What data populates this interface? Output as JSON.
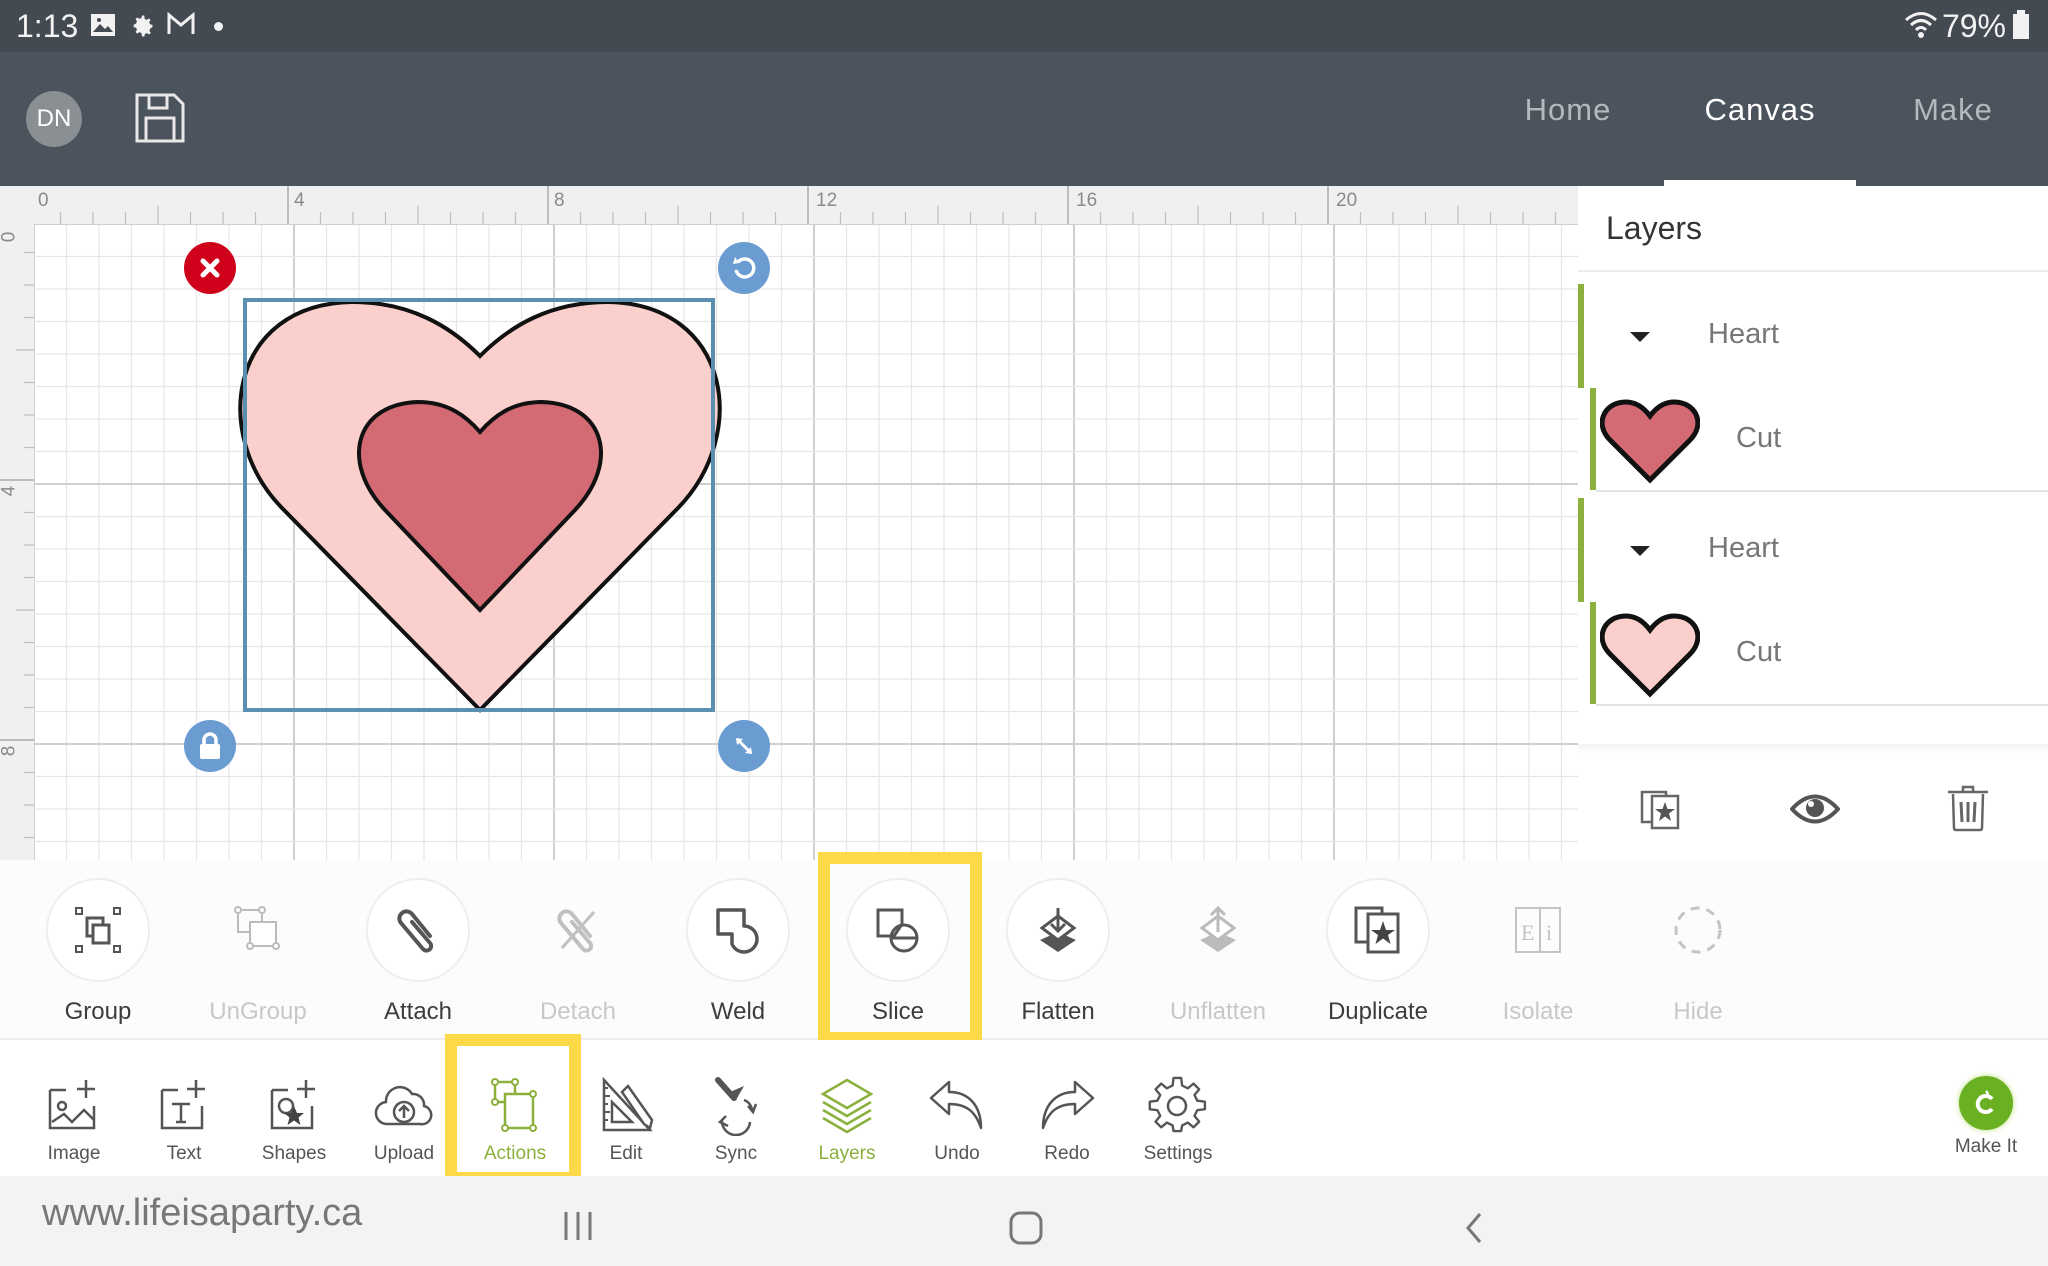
{
  "status_bar": {
    "time": "1:13",
    "left_icons": [
      "gallery-icon",
      "settings-icon",
      "gmail-icon",
      "dot-icon"
    ],
    "battery": "79%"
  },
  "header": {
    "avatar_initials": "DN",
    "save_icon": "floppy-disk-icon",
    "tabs": [
      {
        "label": "Home",
        "active": false
      },
      {
        "label": "Canvas",
        "active": true
      },
      {
        "label": "Make",
        "active": false
      }
    ]
  },
  "canvas": {
    "ruler_top_labels": [
      "0",
      "4",
      "8",
      "12",
      "16",
      "20"
    ],
    "ruler_left_labels": [
      "0",
      "4",
      "8"
    ],
    "selection_handles": [
      "delete-icon",
      "rotate-icon",
      "lock-icon",
      "resize-icon"
    ],
    "colors": {
      "outer_heart": "#fbd0cc",
      "inner_heart": "#d46a74",
      "selection": "#5b8fb0",
      "delete_handle": "#d0021b",
      "handle_blue": "#6a9bd1"
    }
  },
  "layers_panel": {
    "title": "Layers",
    "groups": [
      {
        "name": "Heart",
        "item": {
          "label": "Cut",
          "color": "#d46a74"
        }
      },
      {
        "name": "Heart",
        "item": {
          "label": "Cut",
          "color": "#fbd0cc"
        }
      }
    ],
    "footer_icons": [
      "duplicate-icon",
      "eye-icon",
      "trash-icon"
    ]
  },
  "actions_bar": {
    "items": [
      {
        "label": "Group",
        "icon": "group-icon",
        "enabled": true
      },
      {
        "label": "UnGroup",
        "icon": "ungroup-icon",
        "enabled": false
      },
      {
        "label": "Attach",
        "icon": "paperclip-icon",
        "enabled": true
      },
      {
        "label": "Detach",
        "icon": "detach-icon",
        "enabled": false
      },
      {
        "label": "Weld",
        "icon": "weld-icon",
        "enabled": true
      },
      {
        "label": "Slice",
        "icon": "slice-icon",
        "enabled": true,
        "highlighted": true
      },
      {
        "label": "Flatten",
        "icon": "flatten-icon",
        "enabled": true
      },
      {
        "label": "Unflatten",
        "icon": "unflatten-icon",
        "enabled": false
      },
      {
        "label": "Duplicate",
        "icon": "duplicate-icon",
        "enabled": true
      },
      {
        "label": "Isolate",
        "icon": "isolate-icon",
        "enabled": false
      },
      {
        "label": "Hide",
        "icon": "hide-icon",
        "enabled": false
      }
    ]
  },
  "bottom_toolbar": {
    "items": [
      {
        "label": "Image",
        "icon": "image-add-icon"
      },
      {
        "label": "Text",
        "icon": "text-add-icon"
      },
      {
        "label": "Shapes",
        "icon": "shapes-add-icon"
      },
      {
        "label": "Upload",
        "icon": "upload-cloud-icon"
      },
      {
        "label": "Actions",
        "icon": "actions-icon",
        "active": true,
        "highlighted": true
      },
      {
        "label": "Edit",
        "icon": "edit-ruler-icon"
      },
      {
        "label": "Sync",
        "icon": "sync-icon"
      },
      {
        "label": "Layers",
        "icon": "layers-icon",
        "active": true
      },
      {
        "label": "Undo",
        "icon": "undo-icon"
      },
      {
        "label": "Redo",
        "icon": "redo-icon"
      },
      {
        "label": "Settings",
        "icon": "settings-gear-icon"
      }
    ],
    "make_it": {
      "label": "Make It",
      "color": "#6ab023"
    }
  },
  "nav_bar": {
    "watermark": "www.lifeisaparty.ca",
    "buttons": [
      "recent-apps-icon",
      "home-icon",
      "back-icon"
    ]
  },
  "highlight_color": "#fcd949",
  "accent_green": "#8bb03e"
}
